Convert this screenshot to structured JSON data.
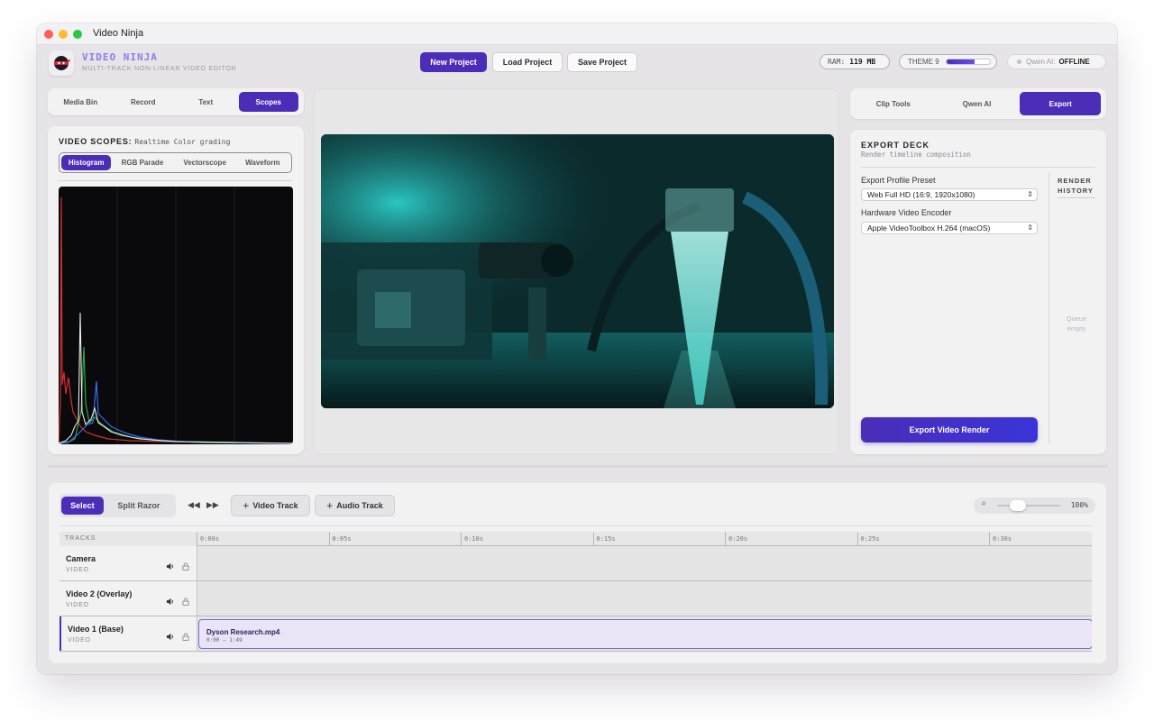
{
  "window": {
    "title": "Video Ninja"
  },
  "brand": {
    "title": "VIDEO NINJA",
    "subtitle": "MULTI-TRACK NON-LINEAR VIDEO EDITOR"
  },
  "toolbar": {
    "new_project": "New Project",
    "load_project": "Load Project",
    "save_project": "Save Project"
  },
  "status": {
    "ram_label": "RAM:",
    "ram_value": "119 MB",
    "theme_label": "THEME 9",
    "theme_level": 0.65,
    "qwen_label": "Qwen AI:",
    "qwen_value": "OFFLINE"
  },
  "left_tabs": [
    "Media Bin",
    "Record",
    "Text",
    "Scopes"
  ],
  "left_active": "Scopes",
  "scopes": {
    "title": "VIDEO SCOPES:",
    "subtitle": "Realtime Color grading",
    "tabs": [
      "Histogram",
      "RGB Parade",
      "Vectorscope",
      "Waveform"
    ],
    "active": "Histogram"
  },
  "right_tabs": [
    "Clip Tools",
    "Qwen AI",
    "Export"
  ],
  "right_active": "Export",
  "export": {
    "title": "EXPORT DECK",
    "subtitle": "Render timeline composition",
    "profile_label": "Export Profile Preset",
    "profile_value": "Web Full HD (16:9, 1920x1080)",
    "encoder_label": "Hardware Video Encoder",
    "encoder_value": "Apple VideoToolbox H.264 (macOS)",
    "history_title": "RENDER HISTORY",
    "queue_empty": "Queue empty",
    "button": "Export Video Render"
  },
  "timeline": {
    "tools": [
      "Select",
      "Split Razor"
    ],
    "active_tool": "Select",
    "add_video": "Video Track",
    "add_audio": "Audio Track",
    "zoom": "100%",
    "zoom_level": 0.2,
    "tracks_header": "TRACKS",
    "ticks": [
      "0:00s",
      "0:05s",
      "0:10s",
      "0:15s",
      "0:20s",
      "0:25s",
      "0:30s"
    ],
    "tracks": [
      {
        "name": "Camera",
        "type": "VIDEO"
      },
      {
        "name": "Video 2 (Overlay)",
        "type": "VIDEO"
      },
      {
        "name": "Video 1 (Base)",
        "type": "VIDEO"
      }
    ],
    "clip": {
      "name": "Dyson Research.mp4",
      "range": "0:00 — 1:49"
    }
  },
  "colors": {
    "accent": "#4b2db8",
    "brand": "#8d7cf0",
    "clip_bg": "#ebe4f6"
  },
  "icons": {
    "logo": "ninja-logo-icon",
    "volume": "speaker-icon",
    "lock": "lock-icon",
    "rewind": "rewind-icon",
    "forward": "fast-forward-icon",
    "plus": "plus-icon",
    "search": "search-icon",
    "chevron": "chevron-up-down-icon"
  }
}
